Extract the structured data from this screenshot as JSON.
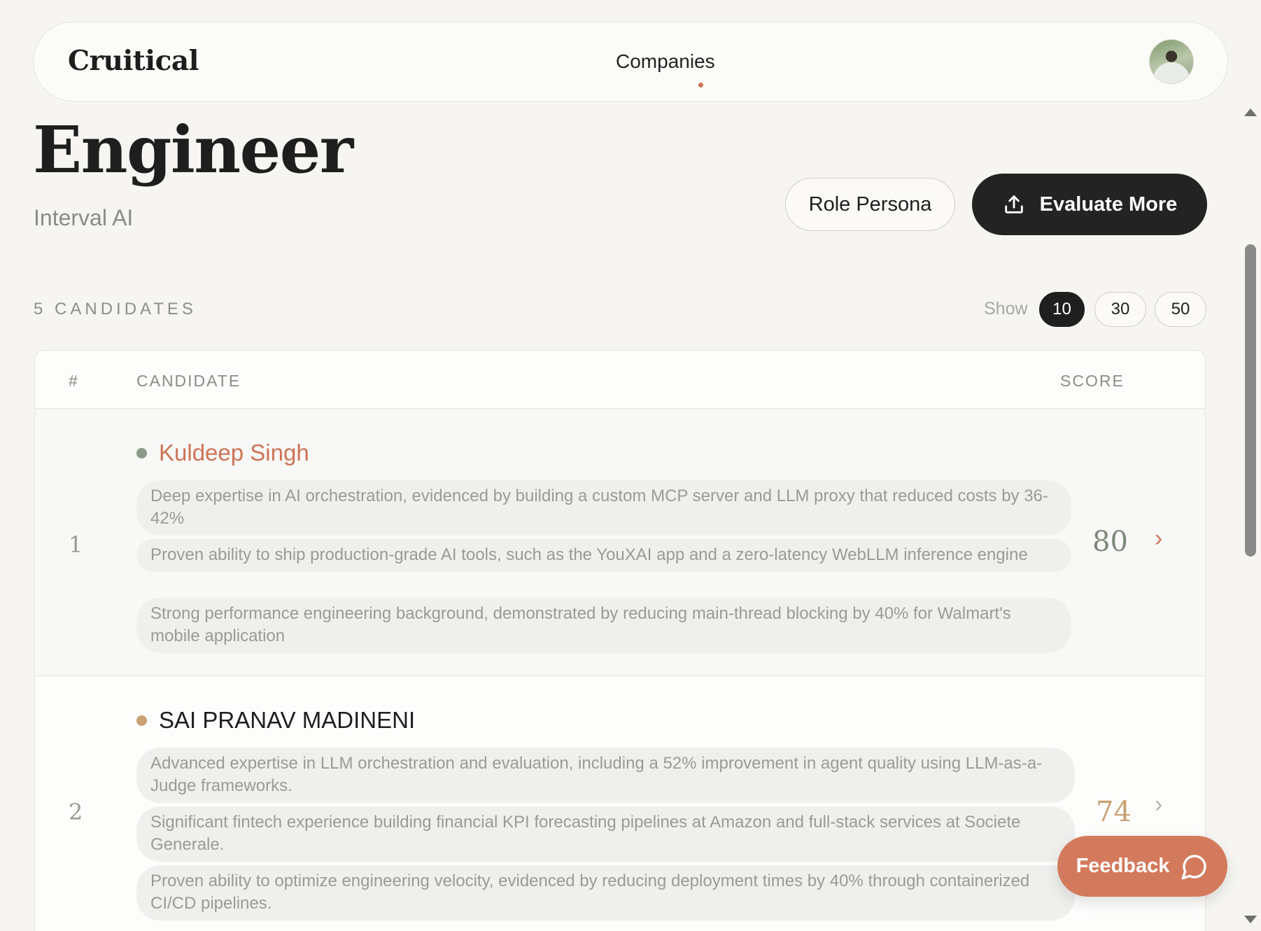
{
  "brand": "Cruitical",
  "nav": {
    "companies_label": "Companies"
  },
  "header": {
    "title": "Engineer",
    "company": "Interval AI",
    "role_persona_label": "Role Persona",
    "evaluate_more_label": "Evaluate More"
  },
  "candidates_meta": {
    "count_label": "5 CANDIDATES",
    "show_label": "Show",
    "page_sizes": [
      "10",
      "30",
      "50"
    ],
    "selected_page_size": "10"
  },
  "table": {
    "headers": {
      "rank": "#",
      "candidate": "CANDIDATE",
      "score": "SCORE"
    },
    "rows": [
      {
        "rank": "1",
        "name": "Kuldeep Singh",
        "name_color": "#cd7356",
        "status_color": "#8a9a86",
        "score": "80",
        "score_color": "#7d8878",
        "bullets": [
          "Deep expertise in AI orchestration, evidenced by building a custom MCP server and LLM proxy that reduced costs by 36-42%",
          "Proven ability to ship production-grade AI tools, such as the YouXAI app and a zero-latency WebLLM inference engine",
          "Strong performance engineering background, demonstrated by reducing main-thread blocking by 40% for Walmart's mobile application"
        ]
      },
      {
        "rank": "2",
        "name": "SAI PRANAV MADINENI",
        "name_color": "#1e1e1e",
        "status_color": "#c9a174",
        "score": "74",
        "score_color": "#c9a174",
        "bullets": [
          "Advanced expertise in LLM orchestration and evaluation, including a 52% improvement in agent quality using LLM-as-a-Judge frameworks.",
          "Significant fintech experience building financial KPI forecasting pipelines at Amazon and full-stack services at Societe Generale.",
          "Proven ability to optimize engineering velocity, evidenced by reducing deployment times by 40% through containerized CI/CD pipelines."
        ]
      }
    ]
  },
  "feedback": {
    "label": "Feedback"
  },
  "icons": {
    "evaluate_more": "upload-icon",
    "feedback": "chat-bubble-icon",
    "row_action": "chevron-right-icon"
  },
  "colors": {
    "accent": "#cd7356",
    "primary_button": "#232323",
    "feedback_button": "#d47a5c"
  }
}
